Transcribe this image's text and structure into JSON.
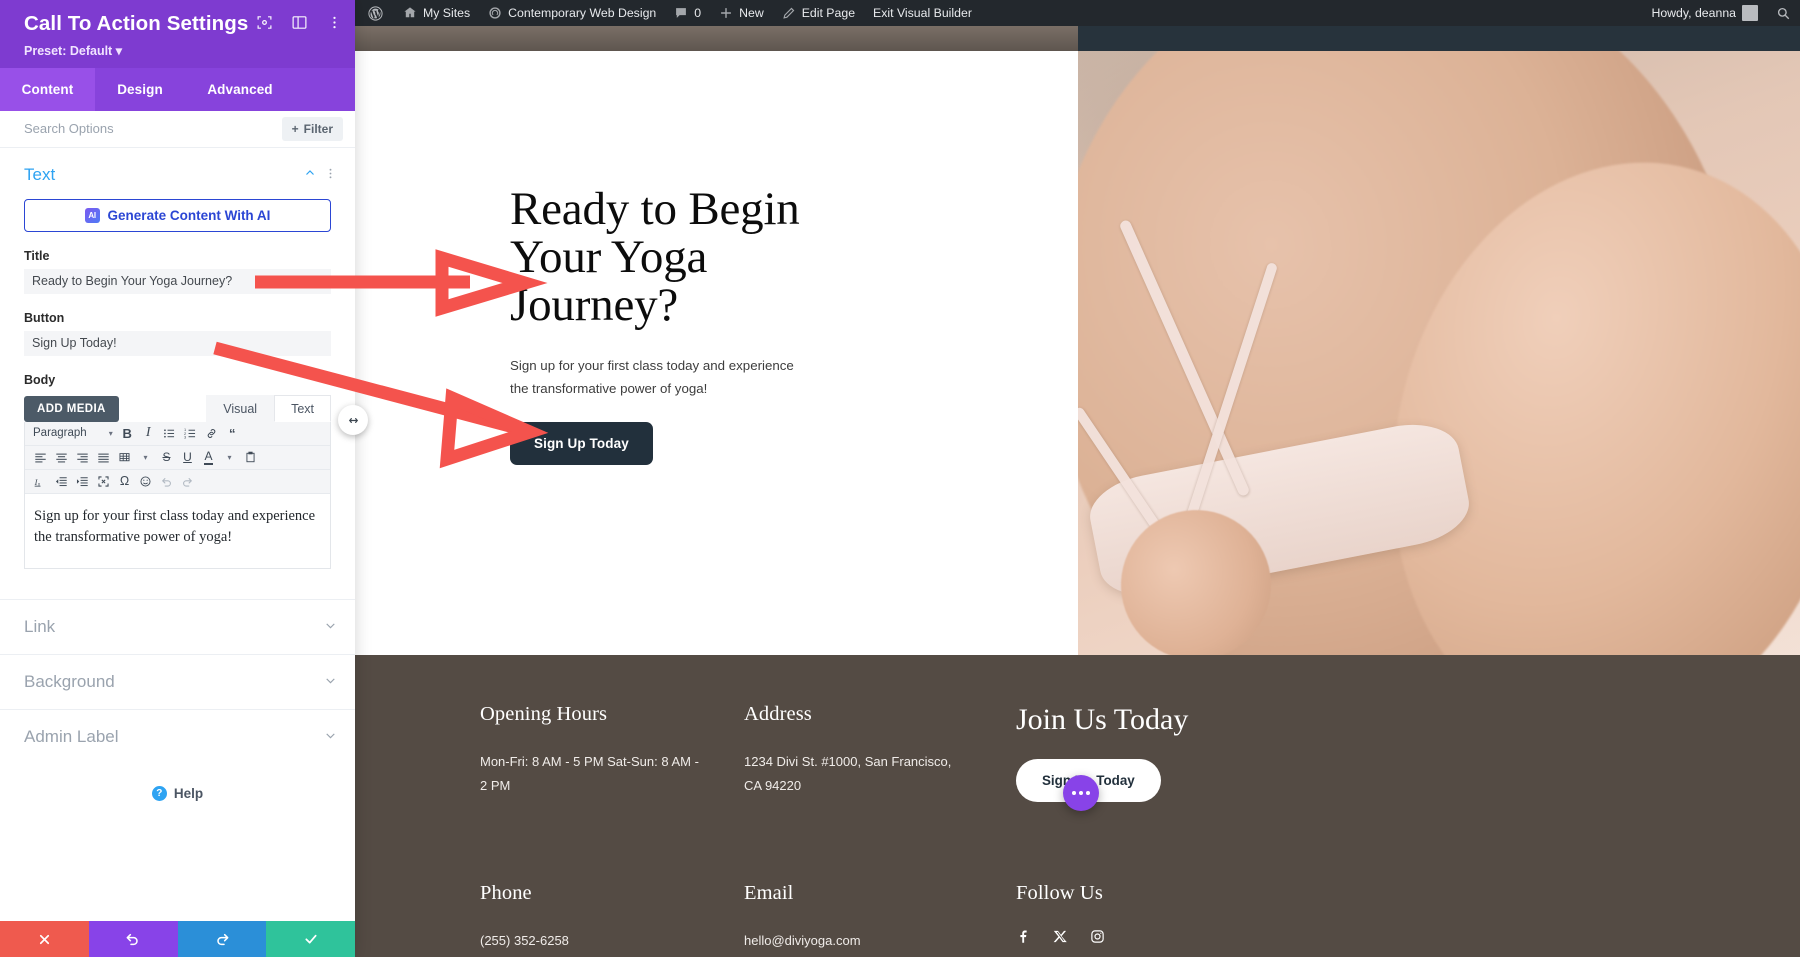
{
  "settings_panel": {
    "title": "Call To Action Settings",
    "preset": "Preset: Default",
    "header_icons": [
      "focus-icon",
      "layout-icon",
      "more-vertical-icon"
    ],
    "tabs": [
      {
        "label": "Content",
        "active": true
      },
      {
        "label": "Design",
        "active": false
      },
      {
        "label": "Advanced",
        "active": false
      }
    ],
    "search_placeholder": "Search Options",
    "filter_label": "Filter",
    "text_section": {
      "title": "Text",
      "ai_button": "Generate Content With AI",
      "ai_badge": "AI",
      "title_label": "Title",
      "title_value": "Ready to Begin Your Yoga Journey?",
      "button_label": "Button",
      "button_value": "Sign Up Today!",
      "body_label": "Body",
      "add_media": "ADD MEDIA",
      "editor_tabs": [
        "Visual",
        "Text"
      ],
      "format_select": "Paragraph",
      "editor_content": "Sign up for your first class today and experience the transformative power of yoga!"
    },
    "collapsed_sections": [
      "Link",
      "Background",
      "Admin Label"
    ],
    "help_label": "Help",
    "actions": [
      "discard-changes",
      "undo",
      "redo",
      "save-changes"
    ]
  },
  "admin_bar": {
    "wp_logo": "wordpress-logo-icon",
    "my_sites": "My Sites",
    "site_name": "Contemporary Web Design",
    "comment_count": "0",
    "new": "New",
    "edit_page": "Edit Page",
    "exit_builder": "Exit Visual Builder",
    "howdy": "Howdy, deanna",
    "search": "search-icon"
  },
  "page": {
    "cta": {
      "title": "Ready to Begin Your Yoga Journey?",
      "body": "Sign up for your first class today and experience the transformative power of yoga!",
      "button": "Sign Up Today"
    },
    "footer": {
      "columns": [
        {
          "heading": "Opening Hours",
          "lines": "Mon-Fri: 8 AM - 5 PM\nSat-Sun: 8 AM - 2 PM"
        },
        {
          "heading": "Address",
          "lines": "1234 Divi St. #1000, San Francisco, CA 94220"
        }
      ],
      "join": {
        "heading": "Join Us Today",
        "button": "Sign Up Today"
      },
      "columns2": [
        {
          "heading": "Phone",
          "lines": "(255) 352-6258"
        },
        {
          "heading": "Email",
          "lines": "hello@diviyoga.com"
        }
      ],
      "follow": {
        "heading": "Follow Us",
        "icons": [
          "facebook-icon",
          "x-twitter-icon",
          "instagram-icon"
        ]
      }
    }
  },
  "colors": {
    "panel_purple": "#7E3BD0",
    "tab_purple": "#9850E8",
    "accent_blue": "#2ea3f2",
    "annotation_red": "#f4534d",
    "footer_brown": "#544b44",
    "cta_button_dark": "#22303c"
  }
}
